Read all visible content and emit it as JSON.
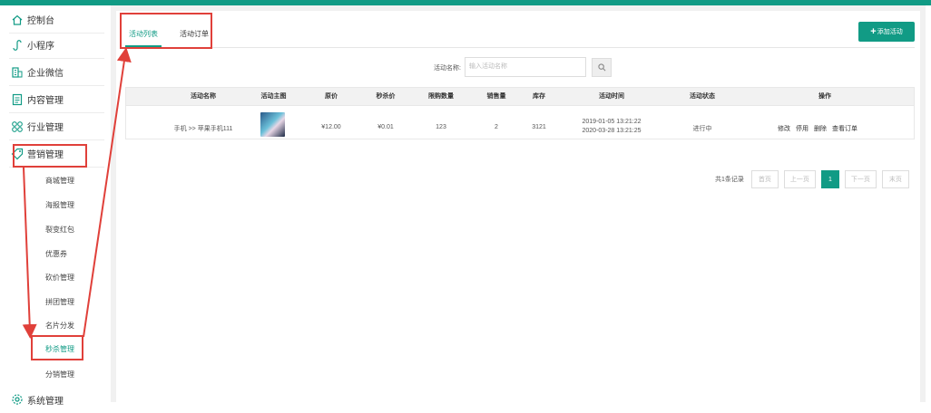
{
  "colors": {
    "accent": "#119b85",
    "annotation": "#e0403a"
  },
  "sidebar": {
    "items": [
      {
        "label": "控制台",
        "icon": "home-icon"
      },
      {
        "label": "小程序",
        "icon": "mini-program-icon"
      },
      {
        "label": "企业微信",
        "icon": "building-icon"
      },
      {
        "label": "内容管理",
        "icon": "document-icon"
      },
      {
        "label": "行业管理",
        "icon": "grid-icon"
      },
      {
        "label": "营销管理",
        "icon": "tag-icon"
      }
    ],
    "subitems": [
      "商城管理",
      "海报管理",
      "裂变红包",
      "优惠券",
      "砍价管理",
      "拼团管理",
      "名片分发",
      "秒杀管理",
      "分销管理"
    ],
    "active_sub": "秒杀管理",
    "bottom_item": {
      "label": "系统管理",
      "icon": "gear-icon"
    }
  },
  "tabs": [
    {
      "label": "活动列表",
      "active": true
    },
    {
      "label": "活动订单",
      "active": false
    }
  ],
  "add_button": {
    "plus": "+",
    "label": "添加活动"
  },
  "search": {
    "label": "活动名称:",
    "placeholder": "输入活动名称",
    "button_icon": "search-icon"
  },
  "table": {
    "headers": [
      "活动名称",
      "活动主图",
      "原价",
      "秒杀价",
      "限购数量",
      "销售量",
      "库存",
      "活动时间",
      "活动状态",
      "操作"
    ],
    "rows": [
      {
        "name": "手机 >> 苹果手机111",
        "original_price": "¥12.00",
        "seckill_price": "¥0.01",
        "limit": "123",
        "sales": "2",
        "stock": "3121",
        "time_start": "2019-01-05 13:21:22",
        "time_end": "2020-03-28 13:21:25",
        "status": "进行中",
        "actions": [
          "修改",
          "停用",
          "删除",
          "查看订单"
        ]
      }
    ]
  },
  "pagination": {
    "total_text": "共1条记录",
    "first": "首页",
    "prev": "上一页",
    "current": "1",
    "next": "下一页",
    "last": "末页"
  }
}
